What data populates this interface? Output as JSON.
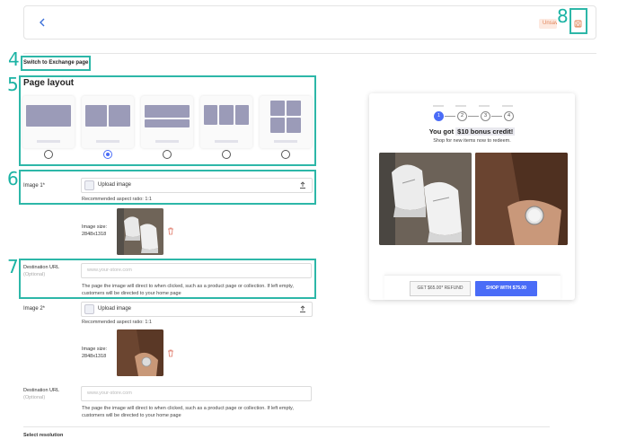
{
  "header": {
    "back_icon": "chevron-left-icon",
    "status_badge": "Unsaved",
    "save_icon": "save-icon"
  },
  "annotations": {
    "n4": "4",
    "n5": "5",
    "n6": "6",
    "n7": "7",
    "n8": "8"
  },
  "switch_link": "Switch to Exchange page",
  "page_layout": {
    "title": "Page layout",
    "options": [
      "single",
      "two-column",
      "two-rows",
      "three-column",
      "grid-2x2"
    ],
    "selected_index": 1
  },
  "image1": {
    "label": "Image 1*",
    "upload_label": "Upload image",
    "aspect_hint": "Recommended aspect ratio: 1:1",
    "size_label": "Image size:",
    "size_value": "2848x1318"
  },
  "destination1": {
    "label": "Destination URL",
    "optional": "(Optional)",
    "placeholder": "www.your-store.com",
    "help": "The page the image will direct to when clicked, such as a product page or collection. If left empty, customers will be directed to your home page"
  },
  "image2": {
    "label": "Image 2*",
    "upload_label": "Upload image",
    "aspect_hint": "Recommended aspect ratio: 1:1",
    "size_label": "Image size:",
    "size_value": "2848x1318"
  },
  "destination2": {
    "label": "Destination URL",
    "optional": "(Optional)",
    "placeholder": "www.your-store.com",
    "help": "The page the image will direct to when clicked, such as a product page or collection. If left empty, customers will be directed to your home page"
  },
  "resolution_label": "Select resolution",
  "preview": {
    "steps": [
      "1",
      "2",
      "3",
      "4"
    ],
    "active_step": 1,
    "title_prefix": "You got",
    "title_highlight": "$10 bonus credit!",
    "subtitle": "Shop for new items now to redeem.",
    "refund_button": "GET $65.00* REFUND",
    "shop_button": "SHOP WITH $75.00"
  },
  "colors": {
    "accent": "#4a6cf7",
    "annotation": "#2db7a8",
    "badge_bg": "#fde9e0",
    "badge_text": "#e0855a"
  }
}
